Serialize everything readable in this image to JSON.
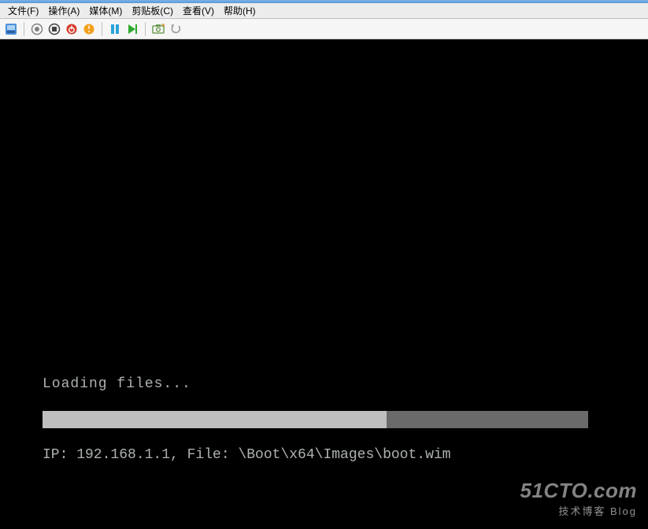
{
  "menu": {
    "file": "文件(F)",
    "action": "操作(A)",
    "media": "媒体(M)",
    "clipboard": "剪贴板(C)",
    "view": "查看(V)",
    "help": "帮助(H)"
  },
  "console": {
    "loading": "Loading files...",
    "status": "IP: 192.168.1.1, File: \\Boot\\x64\\Images\\boot.wim",
    "progress_percent": 63
  },
  "watermark": {
    "line1": "51CTO.com",
    "line2": "技术博客  Blog"
  }
}
